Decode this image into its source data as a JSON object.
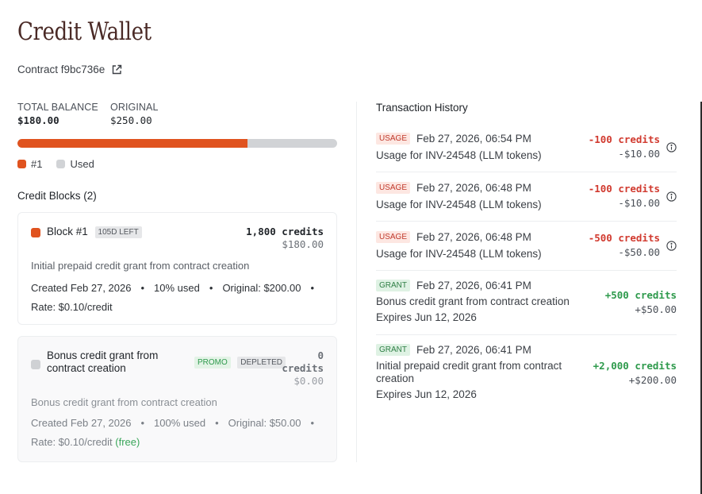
{
  "page": {
    "title": "Credit Wallet"
  },
  "contract": {
    "label": "Contract f9bc736e"
  },
  "balance": {
    "total_label": "TOTAL BALANCE",
    "total_value": "$180.00",
    "original_label": "ORIGINAL",
    "original_value": "$250.00",
    "used_fraction": 0.72
  },
  "legend": {
    "item1": "#1",
    "item2": "Used"
  },
  "colors": {
    "accent": "#e0531f",
    "used": "#d1d3d6",
    "negative": "#d13a2f",
    "positive": "#2e9a4c"
  },
  "blocks": {
    "heading": "Credit Blocks (2)",
    "items": [
      {
        "name": "Block #1",
        "tag": "105D LEFT",
        "credits": "1,800 credits",
        "amount": "$180.00",
        "description": "Initial prepaid credit grant from contract creation",
        "created": "Created Feb 27, 2026",
        "used": "10% used",
        "original": "Original: $200.00",
        "rate": "Rate: $0.10/credit"
      },
      {
        "name": "Bonus credit grant from contract creation",
        "tag1": "PROMO",
        "tag2": "DEPLETED",
        "credits_num": "0",
        "credits_unit": "credits",
        "amount": "$0.00",
        "description": "Bonus credit grant from contract creation",
        "created": "Created Feb 27, 2026",
        "used": "100% used",
        "original": "Original: $50.00",
        "rate": "Rate: $0.10/credit",
        "free": "(free)"
      }
    ]
  },
  "transactions": {
    "heading": "Transaction History",
    "items": [
      {
        "type": "USAGE",
        "date": "Feb 27, 2026, 06:54 PM",
        "desc": "Usage for INV-24548 (LLM tokens)",
        "credits": "-100 credits",
        "amount": "-$10.00"
      },
      {
        "type": "USAGE",
        "date": "Feb 27, 2026, 06:48 PM",
        "desc": "Usage for INV-24548 (LLM tokens)",
        "credits": "-100 credits",
        "amount": "-$10.00"
      },
      {
        "type": "USAGE",
        "date": "Feb 27, 2026, 06:48 PM",
        "desc": "Usage for INV-24548 (LLM tokens)",
        "credits": "-500 credits",
        "amount": "-$50.00"
      },
      {
        "type": "GRANT",
        "date": "Feb 27, 2026, 06:41 PM",
        "desc": "Bonus credit grant from contract creation",
        "expires": "Expires Jun 12, 2026",
        "credits": "+500 credits",
        "amount": "+$50.00"
      },
      {
        "type": "GRANT",
        "date": "Feb 27, 2026, 06:41 PM",
        "desc": "Initial prepaid credit grant from contract creation",
        "expires": "Expires Jun 12, 2026",
        "credits": "+2,000 credits",
        "amount": "+$200.00"
      }
    ]
  },
  "icons": {
    "external": "external-link-icon",
    "info": "info-icon",
    "dot": "•"
  }
}
